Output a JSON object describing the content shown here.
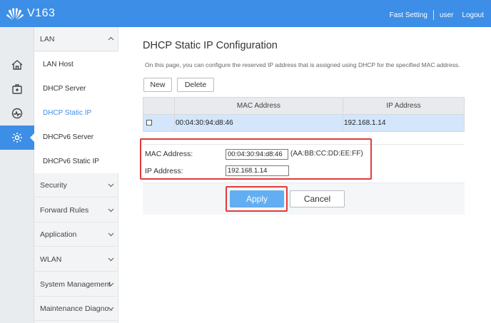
{
  "header": {
    "brand": "V163",
    "nav": {
      "fast_setting": "Fast Setting",
      "user": "user",
      "logout": "Logout"
    }
  },
  "rail": {
    "items": [
      {
        "icon": "home-icon"
      },
      {
        "icon": "medical-kit-icon"
      },
      {
        "icon": "pulse-icon"
      },
      {
        "icon": "gear-icon",
        "active": true
      }
    ]
  },
  "menu": {
    "lan_group": "LAN",
    "lan_items": [
      "LAN Host",
      "DHCP Server",
      "DHCP Static IP",
      "DHCPv6 Server",
      "DHCPv6 Static IP"
    ],
    "active_item": "DHCP Static IP",
    "groups": [
      "Security",
      "Forward Rules",
      "Application",
      "WLAN",
      "System Management",
      "Maintenance Diagno.."
    ]
  },
  "main": {
    "title": "DHCP Static IP Configuration",
    "description": "On this page, you can configure the reserved IP address that is assigned using DHCP for the specified MAC address.",
    "new_label": "New",
    "delete_label": "Delete",
    "table": {
      "headers": [
        "",
        "MAC Address",
        "IP Address"
      ],
      "rows": [
        {
          "mac": "00:04:30:94:d8:46",
          "ip": "192.168.1.14",
          "checked": false
        }
      ]
    },
    "form": {
      "mac_label": "MAC Address:",
      "mac_value": "00:04:30:94:d8:46",
      "mac_hint": "(AA:BB:CC:DD:EE:FF)",
      "ip_label": "IP Address:",
      "ip_value": "192.168.1.14"
    },
    "apply_label": "Apply",
    "cancel_label": "Cancel"
  },
  "colors": {
    "accent": "#3d8ee6",
    "apply": "#62aef2",
    "row_selected": "#d3e6fb",
    "highlight": "#e23a3a"
  }
}
